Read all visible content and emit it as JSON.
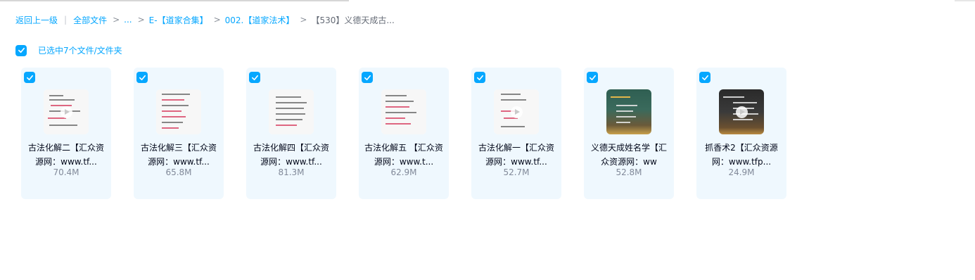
{
  "breadcrumb": {
    "back": "返回上一级",
    "all_files": "全部文件",
    "ellipsis": "...",
    "folder1": "E-【道家合集】",
    "folder2": "002.【道家法术】",
    "current": "【530】义德天成古...",
    "divider": "|",
    "separator": ">"
  },
  "selection": {
    "label": "已选中7个文件/文件夹",
    "checked": true
  },
  "files": [
    {
      "name": "古法化解二【汇众资源网：www.tf...",
      "size": "70.4M",
      "type": "video",
      "checked": true
    },
    {
      "name": "古法化解三【汇众资源网：www.tf...",
      "size": "65.8M",
      "type": "image",
      "checked": true
    },
    {
      "name": "古法化解四【汇众资源网：www.tf...",
      "size": "81.3M",
      "type": "image",
      "checked": true
    },
    {
      "name": "古法化解五 【汇众资源网：www.t...",
      "size": "62.9M",
      "type": "image",
      "checked": true
    },
    {
      "name": "古法化解一【汇众资源网：www.tf...",
      "size": "52.7M",
      "type": "video",
      "checked": true
    },
    {
      "name": "义德天成姓名学【汇众资源网：ww",
      "size": "52.8M",
      "type": "image",
      "checked": true
    },
    {
      "name": "抓香术2【汇众资源网：www.tfp...",
      "size": "24.9M",
      "type": "video",
      "checked": true
    }
  ],
  "colors": {
    "accent": "#06a7ff",
    "card_bg": "#eff8fe",
    "text": "#03081a",
    "muted": "#818999"
  },
  "icons": {
    "check": "check-icon",
    "play": "play-icon",
    "breadcrumb_separator": "chevron-right-icon"
  }
}
